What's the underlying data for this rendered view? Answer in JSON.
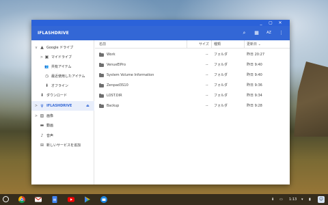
{
  "window": {
    "controls": [
      "_",
      "▢",
      "✕"
    ],
    "title": "IFLASHDRIVE",
    "actions": [
      {
        "icon": "search-icon",
        "glyph": "⌕"
      },
      {
        "icon": "grid-view-icon",
        "glyph": "▦"
      },
      {
        "icon": "sort-az-icon",
        "glyph": "AZ"
      },
      {
        "icon": "more-vert-icon",
        "glyph": "⋮"
      }
    ]
  },
  "sidebar": {
    "items": [
      {
        "label": "Google ドライブ",
        "icon": "drive-icon",
        "glyph": "▲",
        "chevron": "v"
      },
      {
        "label": "マイドライブ",
        "icon": "my-drive-icon",
        "glyph": "▣",
        "chevron": ">"
      },
      {
        "label": "共有アイテム",
        "icon": "shared-icon",
        "glyph": "👥",
        "chevron": ""
      },
      {
        "label": "最近使用したアイテム",
        "icon": "recent-icon",
        "glyph": "◷",
        "chevron": ""
      },
      {
        "label": "オフライン",
        "icon": "offline-icon",
        "glyph": "⬇",
        "chevron": ""
      },
      {
        "label": "ダウンロード",
        "icon": "download-icon",
        "glyph": "⬇",
        "chevron": ""
      },
      {
        "label": "IFLASHDRIVE",
        "icon": "usb-icon",
        "glyph": "ψ",
        "chevron": ">",
        "selected": true,
        "eject": "⏏"
      },
      {
        "label": "画像",
        "icon": "images-icon",
        "glyph": "▨",
        "chevron": ">"
      },
      {
        "label": "動画",
        "icon": "videos-icon",
        "glyph": "▬",
        "chevron": ""
      },
      {
        "label": "音声",
        "icon": "audio-icon",
        "glyph": "♪",
        "chevron": ""
      },
      {
        "label": "新しいサービスを追加",
        "icon": "add-service-icon",
        "glyph": "⊞",
        "chevron": ""
      }
    ]
  },
  "columns": {
    "name": "名前",
    "size": "サイズ",
    "type": "種類",
    "modified": "更新日 ⌄"
  },
  "files": [
    {
      "name": "Work",
      "size": "--",
      "type": "フォルダ",
      "modified": "昨日 20:27"
    },
    {
      "name": "VenueElPro",
      "size": "--",
      "type": "フォルダ",
      "modified": "昨日 9:40"
    },
    {
      "name": "System Volume Information",
      "size": "--",
      "type": "フォルダ",
      "modified": "昨日 9:40"
    },
    {
      "name": "Zenpad3S10",
      "size": "--",
      "type": "フォルダ",
      "modified": "昨日 9:36"
    },
    {
      "name": "LOST.DIR",
      "size": "--",
      "type": "フォルダ",
      "modified": "昨日 9:34"
    },
    {
      "name": "Backup",
      "size": "--",
      "type": "フォルダ",
      "modified": "昨日 9:28"
    }
  ],
  "shelf": {
    "apps": [
      {
        "name": "chrome-icon",
        "color": "#4285f4"
      },
      {
        "name": "gmail-icon",
        "color": "#db4437"
      },
      {
        "name": "docs-icon",
        "color": "#4285f4"
      },
      {
        "name": "youtube-icon",
        "color": "#ff0000"
      },
      {
        "name": "play-store-icon",
        "color": "#34a853"
      },
      {
        "name": "files-icon",
        "color": "#1e88e5"
      }
    ],
    "status": {
      "download": "⬇",
      "screen": "▭",
      "time": "1:13",
      "wifi": "▾",
      "battery": "▮",
      "avatar": "☺"
    }
  },
  "colors": {
    "accent": "#3367d6",
    "titlebar": "#2b62d9",
    "folder": "#6f6f6f"
  }
}
